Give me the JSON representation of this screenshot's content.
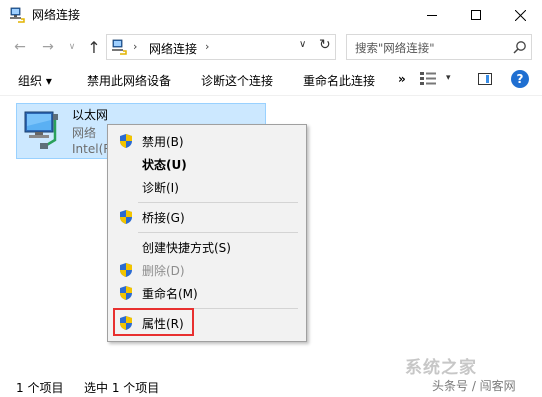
{
  "window": {
    "title": "网络连接"
  },
  "nav": {
    "back_glyph": "←",
    "forward_glyph": "→",
    "recent_glyph": "∨",
    "up_glyph": "↑",
    "address_chevron": "›",
    "address_text": "网络连接",
    "address_dropdown_glyph": "∨",
    "refresh_glyph": "↻",
    "search_placeholder": "搜索\"网络连接\""
  },
  "toolbar": {
    "organize": "组织 ▾",
    "disable_device": "禁用此网络设备",
    "diagnose": "诊断这个连接",
    "rename": "重命名此连接",
    "more": "»",
    "view_dropdown": "▾",
    "help": "?"
  },
  "adapter": {
    "name": "以太网",
    "status": "网络",
    "device": "Intel(R"
  },
  "context_menu": {
    "items": [
      {
        "label": "禁用(B)",
        "shield": true
      },
      {
        "label": "状态(U)",
        "bold": true
      },
      {
        "label": "诊断(I)"
      },
      {
        "label": "桥接(G)",
        "shield": true
      },
      {
        "label": "创建快捷方式(S)"
      },
      {
        "label": "删除(D)",
        "shield": true,
        "disabled": true
      },
      {
        "label": "重命名(M)",
        "shield": true
      },
      {
        "label": "属性(R)",
        "shield": true
      }
    ]
  },
  "statusbar": {
    "item_count": "1 个项目",
    "selected": "选中 1 个项目"
  },
  "watermark": {
    "logo": "系统之家",
    "text": "头条号 / 闯客网"
  },
  "colors": {
    "selection": "#cce8ff",
    "selection_border": "#99d1ff",
    "highlight": "#e8302f",
    "help_blue": "#1f6fd1"
  }
}
